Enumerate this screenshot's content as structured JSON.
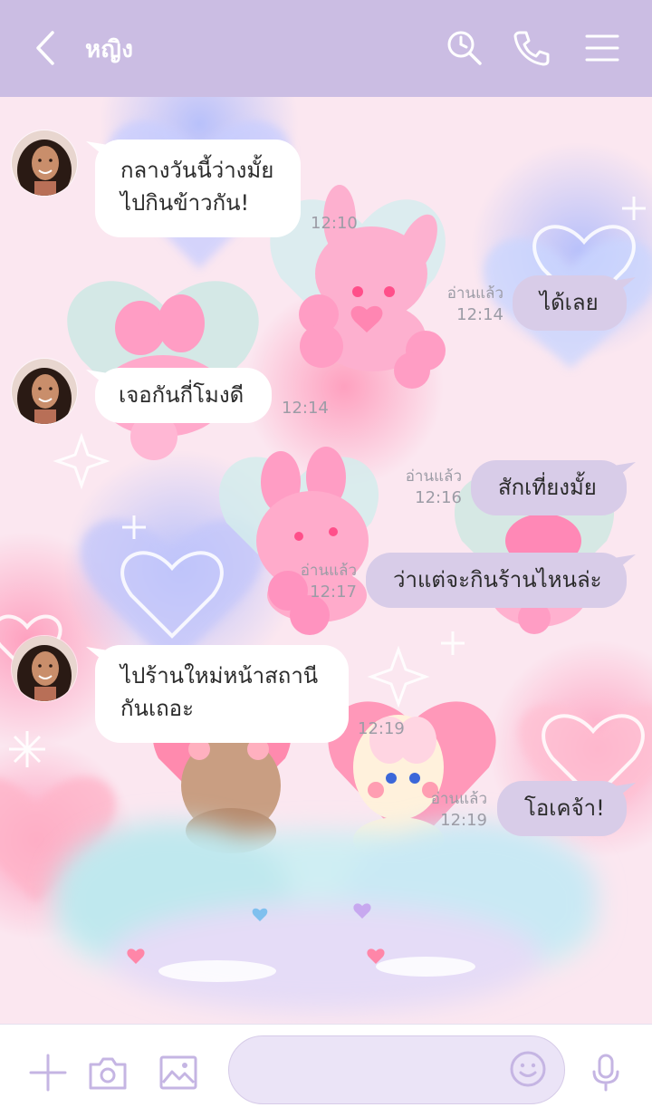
{
  "header": {
    "title": "หญิง",
    "icons": [
      "back-arrow-icon",
      "search-icon",
      "phone-icon",
      "menu-icon"
    ]
  },
  "messages": [
    {
      "side": "in",
      "lines": [
        "กลางวันนี้ว่างมั้ย",
        "ไปกินข้าวกัน!"
      ],
      "time": "12:10"
    },
    {
      "side": "out",
      "text": "ได้เลย",
      "read": "อ่านแล้ว",
      "time": "12:14"
    },
    {
      "side": "in",
      "lines": [
        "เจอกันกี่โมงดี"
      ],
      "time": "12:14"
    },
    {
      "side": "out",
      "text": "สักเที่ยงมั้ย",
      "read": "อ่านแล้ว",
      "time": "12:16"
    },
    {
      "side": "out",
      "text": "ว่าแต่จะกินร้านไหนล่ะ",
      "read": "อ่านแล้ว",
      "time": "12:17"
    },
    {
      "side": "in",
      "lines": [
        "ไปร้านใหม่หน้าสถานี",
        "กันเถอะ"
      ],
      "time": "12:19"
    },
    {
      "side": "out",
      "text": "โอเคจ้า!",
      "read": "อ่านแล้ว",
      "time": "12:19"
    }
  ],
  "footer": {
    "input_placeholder": "",
    "icons": [
      "plus-icon",
      "camera-icon",
      "image-icon",
      "emoji-icon",
      "microphone-icon"
    ]
  },
  "colors": {
    "header": "#cbbde3",
    "outgoing_bubble": "#d8cce8",
    "incoming_bubble": "#ffffff",
    "timestamp": "#9c9ca6"
  }
}
